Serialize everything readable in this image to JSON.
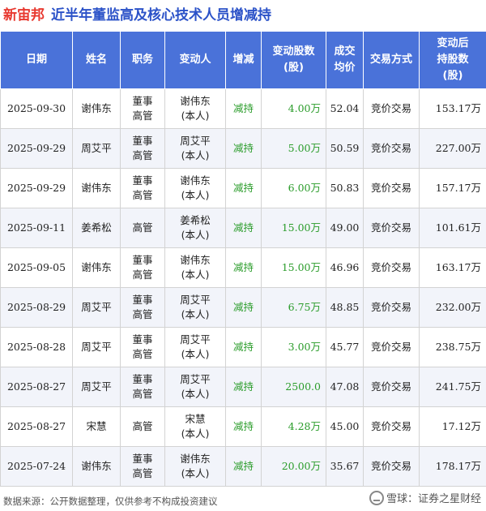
{
  "title": {
    "brand": "新宙邦",
    "text": "近半年董监高及核心技术人员增减持"
  },
  "headers": [
    "日期",
    "姓名",
    "职务",
    "变动人",
    "增减",
    "变动股数\n(股)",
    "成交\n均价",
    "交易方式",
    "变动后\n持股数\n(股)"
  ],
  "rows": [
    {
      "date": "2025-09-30",
      "name": "谢伟东",
      "role": "董事\n高管",
      "changer": "谢伟东\n(本人)",
      "dir": "减持",
      "shares": "4.00万",
      "price": "52.04",
      "method": "竞价交易",
      "after": "153.17万"
    },
    {
      "date": "2025-09-29",
      "name": "周艾平",
      "role": "董事\n高管",
      "changer": "周艾平\n(本人)",
      "dir": "减持",
      "shares": "5.00万",
      "price": "50.59",
      "method": "竞价交易",
      "after": "227.00万"
    },
    {
      "date": "2025-09-29",
      "name": "谢伟东",
      "role": "董事\n高管",
      "changer": "谢伟东\n(本人)",
      "dir": "减持",
      "shares": "6.00万",
      "price": "50.83",
      "method": "竞价交易",
      "after": "157.17万"
    },
    {
      "date": "2025-09-11",
      "name": "姜希松",
      "role": "高管",
      "changer": "姜希松\n(本人)",
      "dir": "减持",
      "shares": "15.00万",
      "price": "49.00",
      "method": "竞价交易",
      "after": "101.61万"
    },
    {
      "date": "2025-09-05",
      "name": "谢伟东",
      "role": "董事\n高管",
      "changer": "谢伟东\n(本人)",
      "dir": "减持",
      "shares": "15.00万",
      "price": "46.96",
      "method": "竞价交易",
      "after": "163.17万"
    },
    {
      "date": "2025-08-29",
      "name": "周艾平",
      "role": "董事\n高管",
      "changer": "周艾平\n(本人)",
      "dir": "减持",
      "shares": "6.75万",
      "price": "48.85",
      "method": "竞价交易",
      "after": "232.00万"
    },
    {
      "date": "2025-08-28",
      "name": "周艾平",
      "role": "董事\n高管",
      "changer": "周艾平\n(本人)",
      "dir": "减持",
      "shares": "3.00万",
      "price": "45.77",
      "method": "竞价交易",
      "after": "238.75万"
    },
    {
      "date": "2025-08-27",
      "name": "周艾平",
      "role": "董事\n高管",
      "changer": "周艾平\n(本人)",
      "dir": "减持",
      "shares": "2500.0",
      "price": "47.08",
      "method": "竞价交易",
      "after": "241.75万"
    },
    {
      "date": "2025-08-27",
      "name": "宋慧",
      "role": "高管",
      "changer": "宋慧\n(本人)",
      "dir": "减持",
      "shares": "4.28万",
      "price": "45.00",
      "method": "竞价交易",
      "after": "17.12万"
    },
    {
      "date": "2025-07-24",
      "name": "谢伟东",
      "role": "董事\n高管",
      "changer": "谢伟东\n(本人)",
      "dir": "减持",
      "shares": "20.00万",
      "price": "35.67",
      "method": "竞价交易",
      "after": "178.17万"
    }
  ],
  "footer": "数据来源：公开数据整理，仅供参考不构成投资建议",
  "watermark": "雪球：证券之星财经",
  "colors": {
    "header_bg": "#4a72d9",
    "brand": "#e8382f",
    "title": "#2b52c8",
    "decrease": "#2a9c2a"
  }
}
